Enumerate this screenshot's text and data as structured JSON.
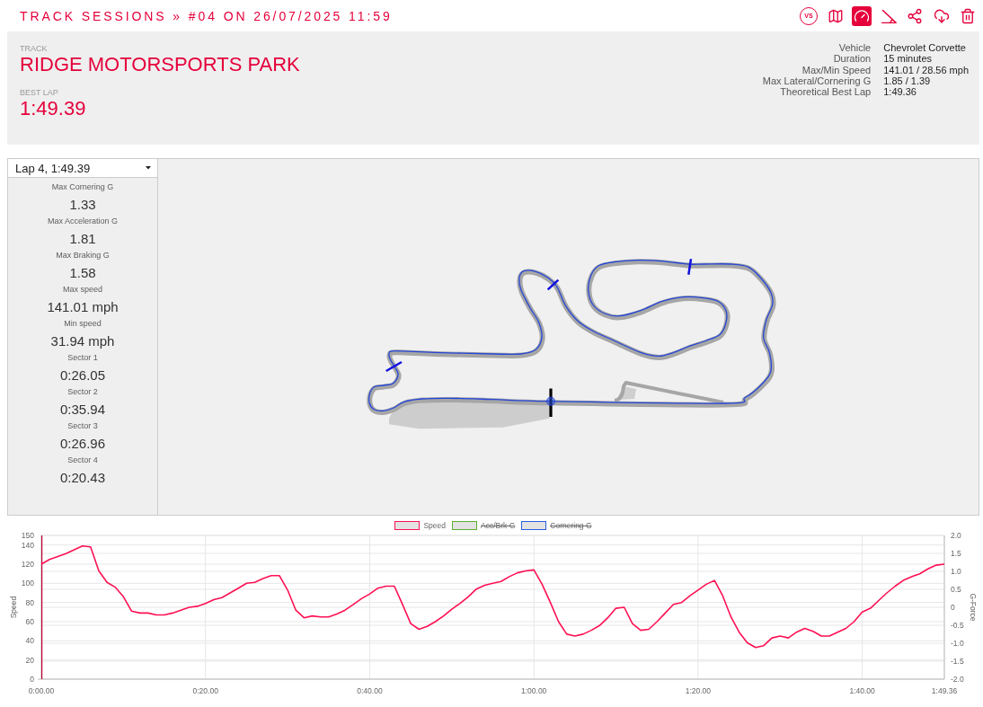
{
  "header": {
    "title": "TRACK SESSIONS » #04 ON 26/07/2025 11:59"
  },
  "toolbar": [
    {
      "kind": "versus",
      "label": "VS",
      "selected": false
    },
    {
      "kind": "map",
      "selected": false
    },
    {
      "kind": "gauge",
      "selected": true
    },
    {
      "kind": "angle",
      "selected": false
    },
    {
      "kind": "share",
      "selected": false
    },
    {
      "kind": "download",
      "selected": false
    },
    {
      "kind": "trash",
      "selected": false
    }
  ],
  "summary": {
    "track_label": "TRACK",
    "track_name": "RIDGE MOTORSPORTS PARK",
    "best_lap_label": "BEST LAP",
    "best_lap": "1:49.39",
    "details": [
      {
        "label": "Vehicle",
        "value": "Chevrolet Corvette"
      },
      {
        "label": "Duration",
        "value": "15 minutes"
      },
      {
        "label": "Max/Min Speed",
        "value": "141.01 / 28.56 mph"
      },
      {
        "label": "Max Lateral/Cornering G",
        "value": "1.85 / 1.39"
      },
      {
        "label": "Theoretical Best Lap",
        "value": "1:49.36"
      }
    ]
  },
  "lap_select": {
    "value": "Lap 4, 1:49.39"
  },
  "lap_stats": [
    {
      "label": "Max Cornering G",
      "value": "1.33"
    },
    {
      "label": "Max Acceleration G",
      "value": "1.81"
    },
    {
      "label": "Max Braking G",
      "value": "1.58"
    },
    {
      "label": "Max speed",
      "value": "141.01 mph"
    },
    {
      "label": "Min speed",
      "value": "31.94 mph"
    },
    {
      "label": "Sector 1",
      "value": "0:26.05"
    },
    {
      "label": "Sector 2",
      "value": "0:35.94"
    },
    {
      "label": "Sector 3",
      "value": "0:26.96"
    },
    {
      "label": "Sector 4",
      "value": "0:20.43"
    }
  ],
  "chart": {
    "legend": [
      {
        "label": "Acc/Brk G",
        "color": "#5cb030",
        "hidden": true
      },
      {
        "label": "Cornering G",
        "color": "#2b5fe0",
        "hidden": true
      }
    ],
    "right_axis": {
      "label": "G-Force",
      "ticks": [
        "2.0",
        "1.5",
        "1.0",
        "0.5",
        "0",
        "-0.5",
        "-1.0",
        "-1.5",
        "-2.0"
      ]
    },
    "chart_data": {
      "type": "line",
      "ylabel": "Speed",
      "grid": true,
      "categories": [
        "0:00.00",
        null,
        null,
        null,
        null,
        null,
        null,
        null,
        null,
        null,
        null,
        null,
        null,
        null,
        null,
        null,
        null,
        null,
        null,
        null,
        "0:20.00",
        null,
        null,
        null,
        null,
        null,
        null,
        null,
        null,
        null,
        null,
        null,
        null,
        null,
        null,
        null,
        null,
        null,
        null,
        null,
        "0:40.00",
        null,
        null,
        null,
        null,
        null,
        null,
        null,
        null,
        null,
        null,
        null,
        null,
        null,
        null,
        null,
        null,
        null,
        null,
        null,
        "1:00.00",
        null,
        null,
        null,
        null,
        null,
        null,
        null,
        null,
        null,
        null,
        null,
        null,
        null,
        null,
        null,
        null,
        null,
        null,
        null,
        "1:20.00",
        null,
        null,
        null,
        null,
        null,
        null,
        null,
        null,
        null,
        null,
        null,
        null,
        null,
        null,
        null,
        null,
        null,
        null,
        null,
        "1:40.00",
        null,
        null,
        null,
        null,
        null,
        null,
        null,
        null,
        null,
        "1:49.36"
      ],
      "series": [
        {
          "name": "Speed",
          "color": "#ff1053",
          "values": [
            120,
            125,
            128,
            131,
            135,
            139,
            138,
            113,
            101,
            96,
            86,
            71,
            69,
            69,
            67,
            67,
            69,
            72,
            75,
            76,
            79,
            83,
            85,
            90,
            95,
            100,
            101,
            105,
            108,
            108,
            93,
            72,
            64,
            66,
            65,
            65,
            68,
            72,
            78,
            84,
            89,
            95,
            97,
            97,
            78,
            58,
            52,
            55,
            60,
            66,
            73,
            79,
            86,
            94,
            98,
            100,
            102,
            107,
            111,
            113,
            114,
            99,
            80,
            60,
            47,
            45,
            47,
            51,
            56,
            64,
            74,
            75,
            58,
            51,
            52,
            60,
            69,
            78,
            80,
            87,
            93,
            99,
            103,
            87,
            65,
            49,
            38,
            33,
            35,
            43,
            45,
            43,
            49,
            53,
            50,
            45,
            45,
            49,
            53,
            60,
            70,
            74,
            82,
            90,
            97,
            103,
            107,
            110,
            115,
            119,
            120
          ]
        }
      ],
      "ylim": [
        0,
        150
      ],
      "yticks": [
        0,
        20,
        40,
        60,
        80,
        100,
        120,
        140,
        150
      ]
    }
  }
}
